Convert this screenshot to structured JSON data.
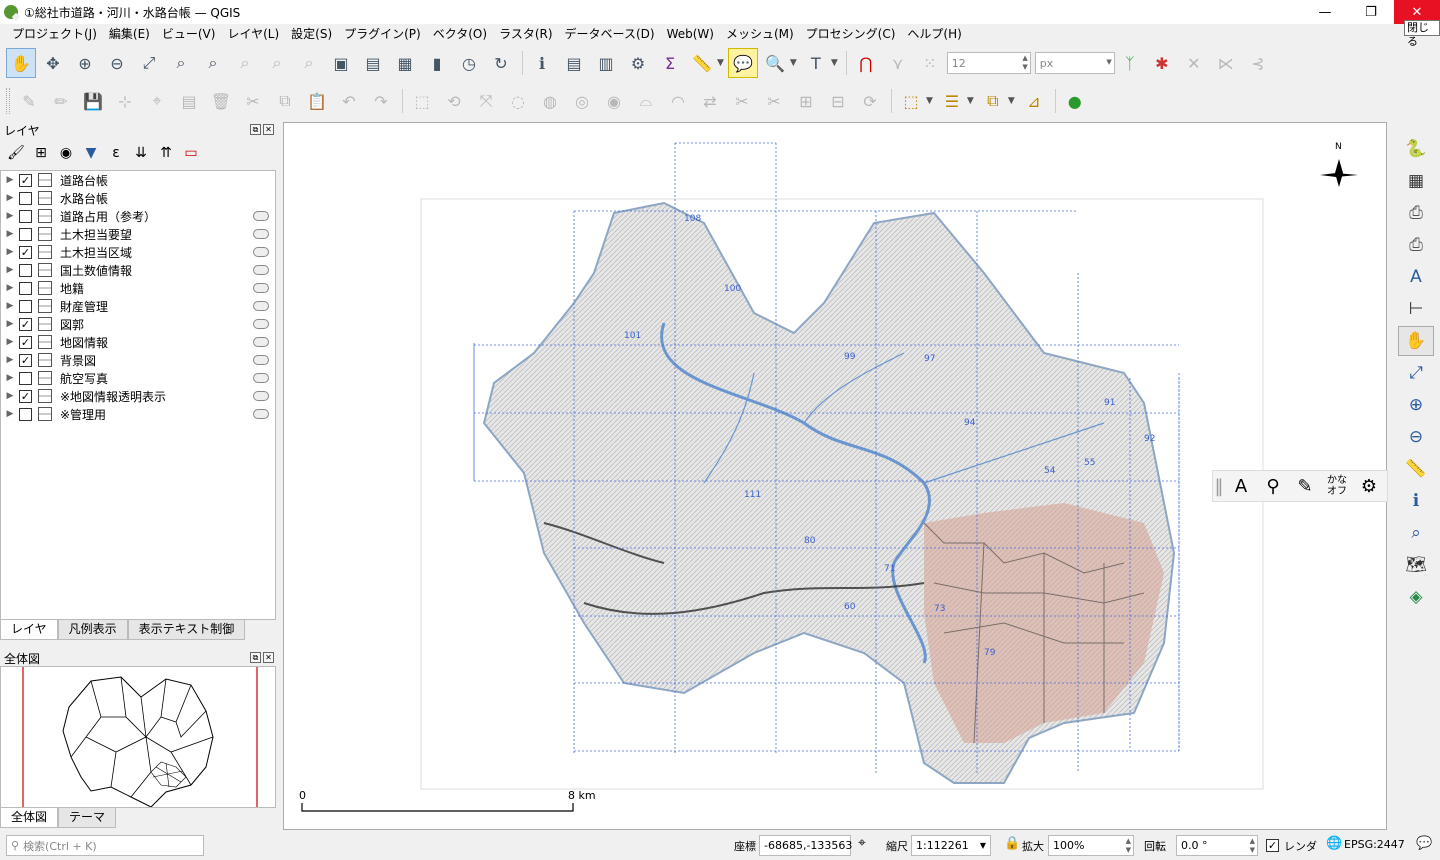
{
  "window": {
    "title": "①総社市道路・河川・水路台帳 — QGIS",
    "min_glyph": "—",
    "max_glyph": "❐",
    "close_glyph": "✕",
    "close_tooltip": "閉じる"
  },
  "menu": [
    "プロジェクト(J)",
    "編集(E)",
    "ビュー(V)",
    "レイヤ(L)",
    "設定(S)",
    "プラグイン(P)",
    "ベクタ(O)",
    "ラスタ(R)",
    "データベース(D)",
    "Web(W)",
    "メッシュ(M)",
    "プロセシング(C)",
    "ヘルプ(H)"
  ],
  "toolbar": {
    "font_size_value": "12",
    "unit_value": "px"
  },
  "layers_panel": {
    "title": "レイヤ",
    "layers": [
      {
        "name": "道路台帳",
        "checked": true
      },
      {
        "name": "水路台帳",
        "checked": false
      },
      {
        "name": "道路占用（参考）",
        "checked": false
      },
      {
        "name": "土木担当要望",
        "checked": false
      },
      {
        "name": "土木担当区域",
        "checked": true
      },
      {
        "name": "国土数値情報",
        "checked": false
      },
      {
        "name": "地籍",
        "checked": false
      },
      {
        "name": "財産管理",
        "checked": false
      },
      {
        "name": "図郭",
        "checked": true
      },
      {
        "name": "地図情報",
        "checked": true
      },
      {
        "name": "背景図",
        "checked": true
      },
      {
        "name": "航空写真",
        "checked": false
      },
      {
        "name": "※地図情報透明表示",
        "checked": true
      },
      {
        "name": "※管理用",
        "checked": false
      }
    ],
    "tabs": [
      "レイヤ",
      "凡例表示",
      "表示テキスト制御"
    ]
  },
  "overview_panel": {
    "title": "全体図",
    "tabs": [
      "全体図",
      "テーマ"
    ]
  },
  "map": {
    "north_label": "N",
    "scalebar_start": "0",
    "scalebar_end": "8 km",
    "tile_numbers": [
      "108",
      "100",
      "101",
      "99",
      "97",
      "94",
      "91",
      "92",
      "54",
      "55",
      "111",
      "80",
      "71",
      "73",
      "79",
      "60"
    ]
  },
  "map_float_toolbar": {
    "kana_line1": "かな",
    "kana_line2": "オフ"
  },
  "statusbar": {
    "locator_placeholder": "検索(Ctrl + K)",
    "coord_label": "座標",
    "coord_value": "-68685,-133563",
    "scale_label": "縮尺",
    "scale_value": "1:112261",
    "magnifier_label": "拡大",
    "magnifier_value": "100%",
    "rotation_label": "回転",
    "rotation_value": "0.0 °",
    "render_label": "レンダ",
    "crs_value": "EPSG:2447"
  }
}
